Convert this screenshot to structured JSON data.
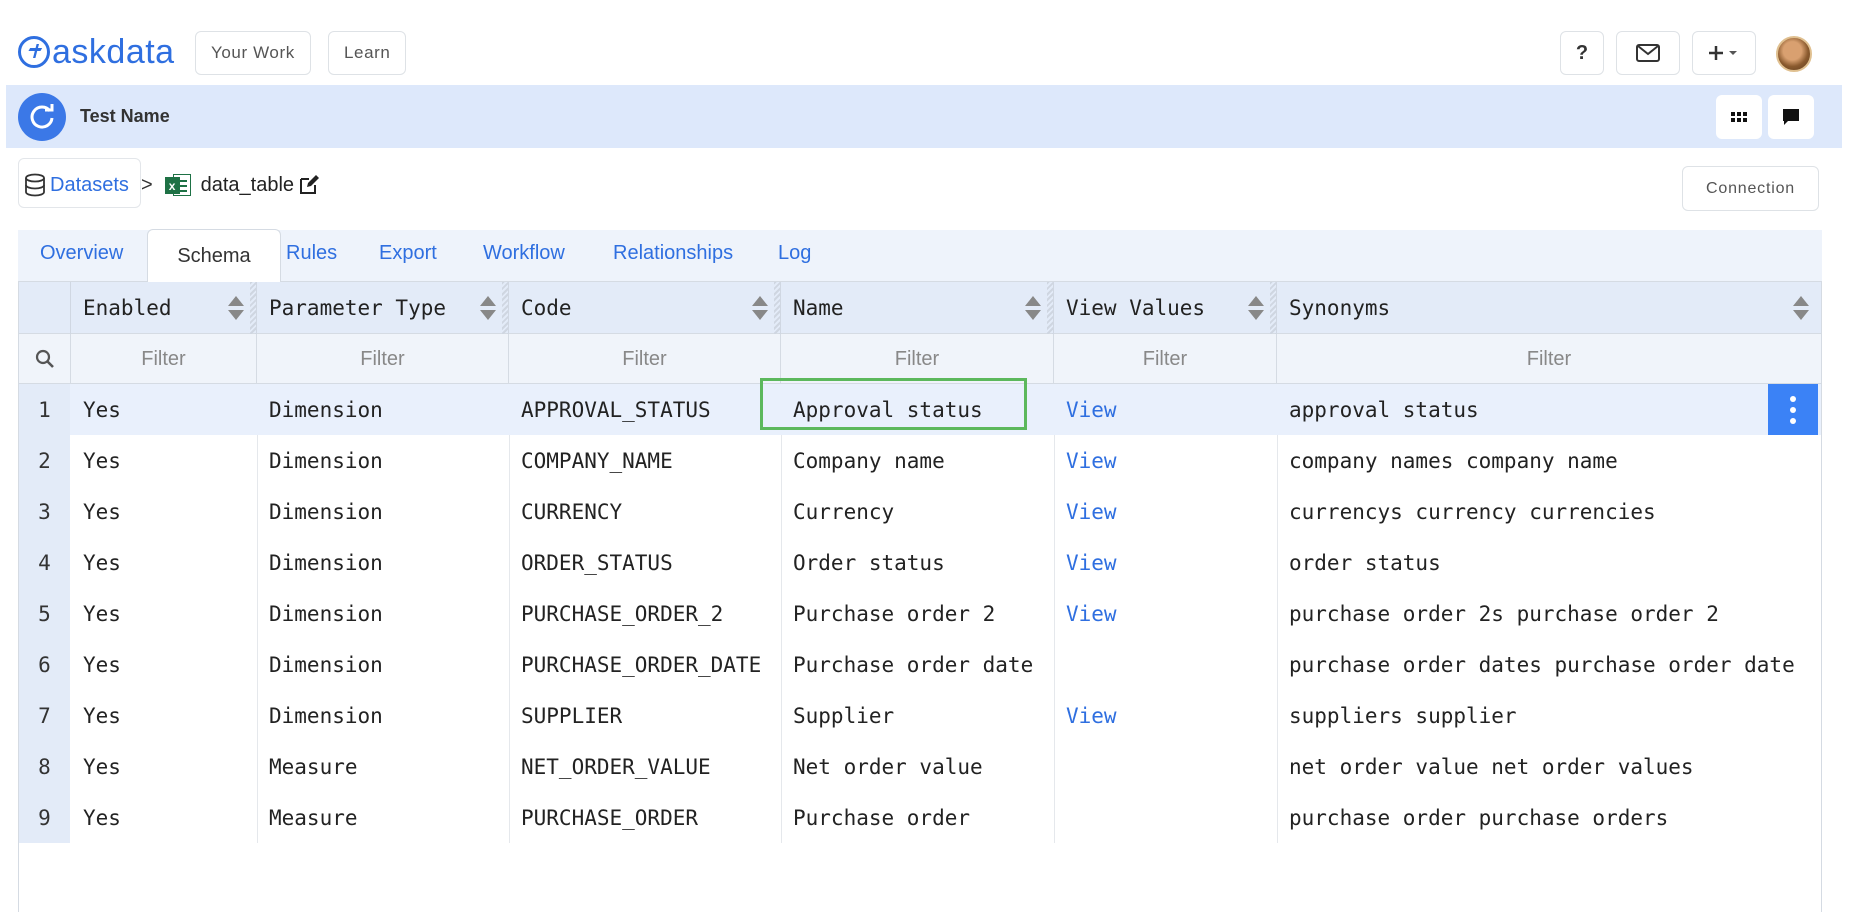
{
  "brand": {
    "name": "askdata"
  },
  "nav": {
    "your_work": "Your Work",
    "learn": "Learn",
    "help": "?"
  },
  "header": {
    "title": "Test Name"
  },
  "breadcrumb": {
    "root": "Datasets",
    "separator": ">",
    "current": "data_table",
    "file_badge": "x"
  },
  "connection_button": "Connection",
  "tabs": [
    "Overview",
    "Schema",
    "Rules",
    "Export",
    "Workflow",
    "Relationships",
    "Log"
  ],
  "active_tab": "Schema",
  "grid": {
    "columns": [
      "Enabled",
      "Parameter Type",
      "Code",
      "Name",
      "View Values",
      "Synonyms"
    ],
    "filter_placeholder": "Filter",
    "rows": [
      {
        "num": "1",
        "enabled": "Yes",
        "type": "Dimension",
        "code": "APPROVAL_STATUS",
        "name": "Approval status",
        "view": "View",
        "synonyms": "approval status"
      },
      {
        "num": "2",
        "enabled": "Yes",
        "type": "Dimension",
        "code": "COMPANY_NAME",
        "name": "Company name",
        "view": "View",
        "synonyms": "company names company name"
      },
      {
        "num": "3",
        "enabled": "Yes",
        "type": "Dimension",
        "code": "CURRENCY",
        "name": "Currency",
        "view": "View",
        "synonyms": "currencys currency currencies"
      },
      {
        "num": "4",
        "enabled": "Yes",
        "type": "Dimension",
        "code": "ORDER_STATUS",
        "name": "Order status",
        "view": "View",
        "synonyms": "order status"
      },
      {
        "num": "5",
        "enabled": "Yes",
        "type": "Dimension",
        "code": "PURCHASE_ORDER_2",
        "name": "Purchase order 2",
        "view": "View",
        "synonyms": "purchase order 2s purchase order 2"
      },
      {
        "num": "6",
        "enabled": "Yes",
        "type": "Dimension",
        "code": "PURCHASE_ORDER_DATE",
        "name": "Purchase order date",
        "view": "",
        "synonyms": "purchase order dates purchase order date"
      },
      {
        "num": "7",
        "enabled": "Yes",
        "type": "Dimension",
        "code": "SUPPLIER",
        "name": "Supplier",
        "view": "View",
        "synonyms": "suppliers supplier"
      },
      {
        "num": "8",
        "enabled": "Yes",
        "type": "Measure",
        "code": "NET_ORDER_VALUE",
        "name": "Net order value",
        "view": "",
        "synonyms": "net order value net order values"
      },
      {
        "num": "9",
        "enabled": "Yes",
        "type": "Measure",
        "code": "PURCHASE_ORDER",
        "name": "Purchase order",
        "view": "",
        "synonyms": "purchase order purchase orders"
      }
    ]
  },
  "icons": {
    "logo": "askdata-logo-icon",
    "mail": "envelope-icon",
    "add": "plus-dropdown-icon",
    "refresh": "refresh-icon",
    "apps": "grid-dots-icon",
    "chat": "chat-bubble-icon",
    "database": "database-icon",
    "excel": "excel-file-icon",
    "edit": "edit-icon",
    "search": "search-icon",
    "sort": "sort-icon",
    "more": "kebab-menu-icon"
  },
  "colors": {
    "accent": "#2f6fe0",
    "header_bar": "#dde8fb",
    "focus": "#5cb85c",
    "kebab": "#3b82f6"
  }
}
